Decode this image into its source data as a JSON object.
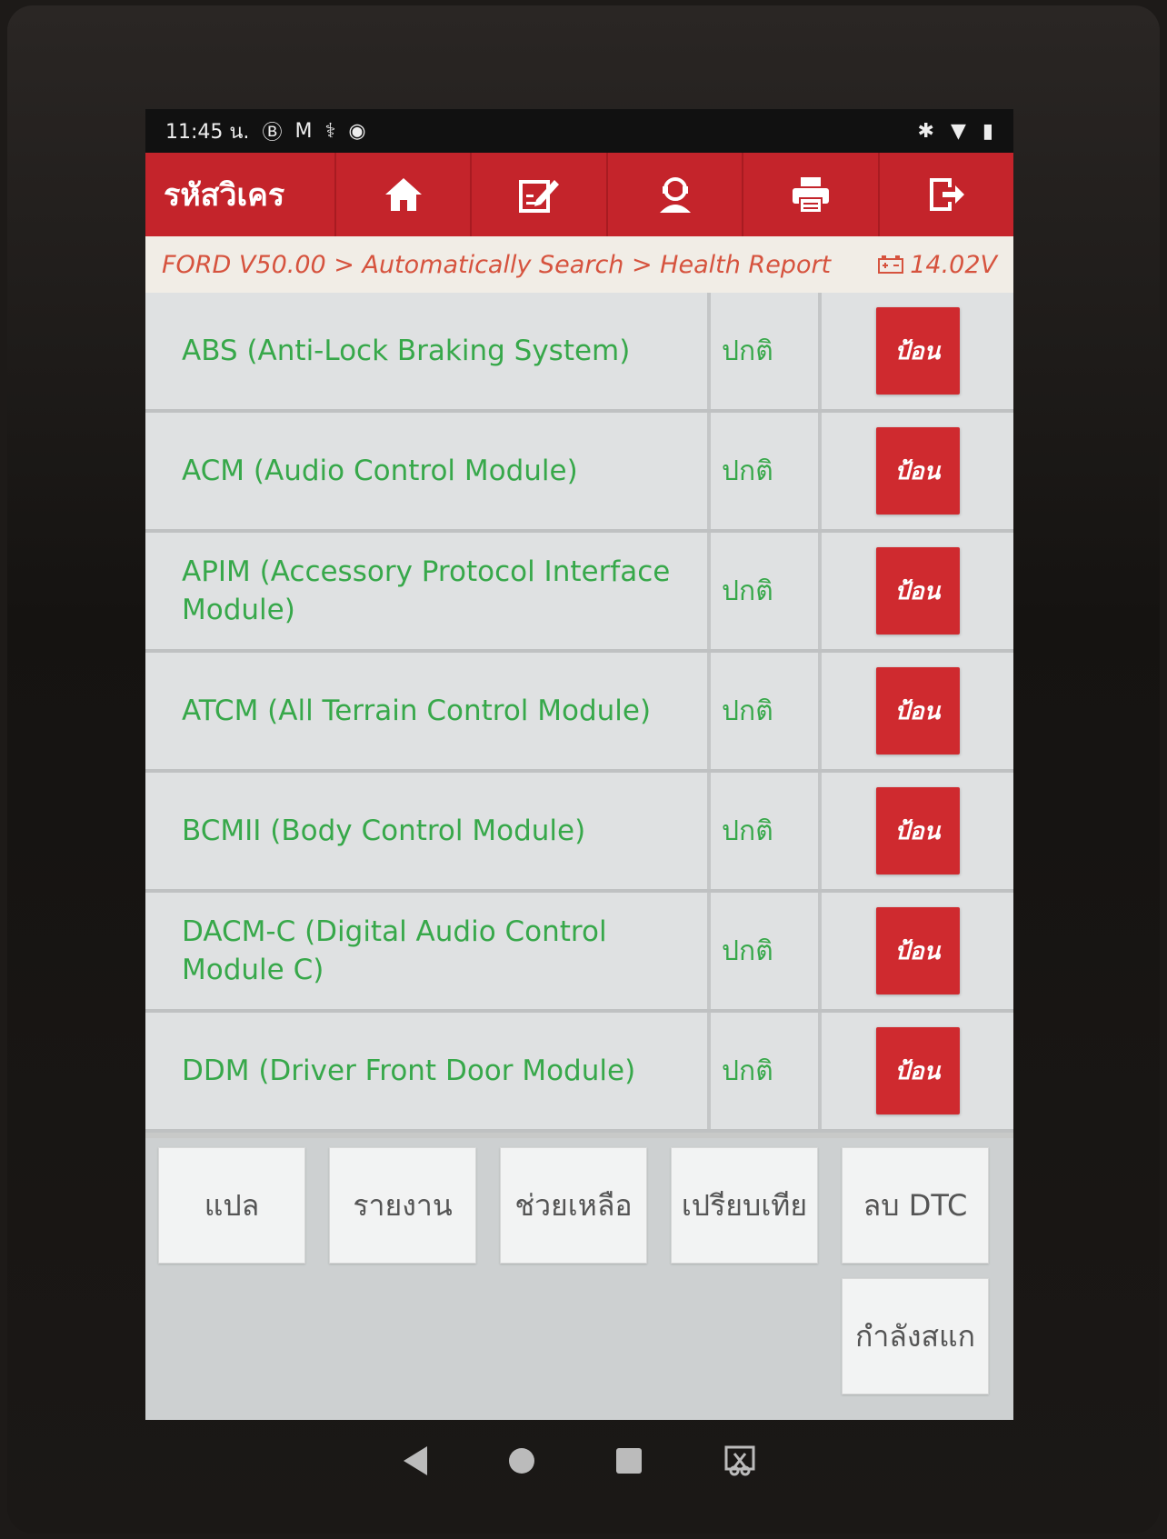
{
  "status_bar": {
    "time": "11:45 น.",
    "left_icons": [
      "bluetooth-audio-icon",
      "gmail-icon",
      "usb-debug-icon",
      "app-icon"
    ],
    "right_icons": [
      "bluetooth-icon",
      "wifi-icon",
      "battery-icon"
    ]
  },
  "toolbar": {
    "title": "รหัสวิเคร",
    "buttons": [
      "home-icon",
      "edit-icon",
      "user-icon",
      "print-icon",
      "exit-icon"
    ]
  },
  "breadcrumb": {
    "path": "FORD V50.00 > Automatically Search > Health Report",
    "voltage": "14.02V"
  },
  "modules": [
    {
      "name": "ABS (Anti-Lock Braking System)",
      "status": "ปกติ",
      "action": "ป้อน"
    },
    {
      "name": "ACM (Audio Control Module)",
      "status": "ปกติ",
      "action": "ป้อน"
    },
    {
      "name": "APIM (Accessory Protocol Interface Module)",
      "status": "ปกติ",
      "action": "ป้อน"
    },
    {
      "name": "ATCM (All Terrain Control Module)",
      "status": "ปกติ",
      "action": "ป้อน"
    },
    {
      "name": "BCMII (Body Control Module)",
      "status": "ปกติ",
      "action": "ป้อน"
    },
    {
      "name": "DACM-C (Digital Audio Control Module C)",
      "status": "ปกติ",
      "action": "ป้อน"
    },
    {
      "name": "DDM (Driver Front Door Module)",
      "status": "ปกติ",
      "action": "ป้อน"
    }
  ],
  "bottom_buttons": [
    "แปล",
    "รายงาน",
    "ช่วยเหลือ",
    "เปรียบเทีย",
    "ลบ DTC",
    "กำลังสแก"
  ],
  "colors": {
    "accent": "#c4242b",
    "text_green": "#37a84a",
    "breadcrumb": "#d6533e"
  }
}
